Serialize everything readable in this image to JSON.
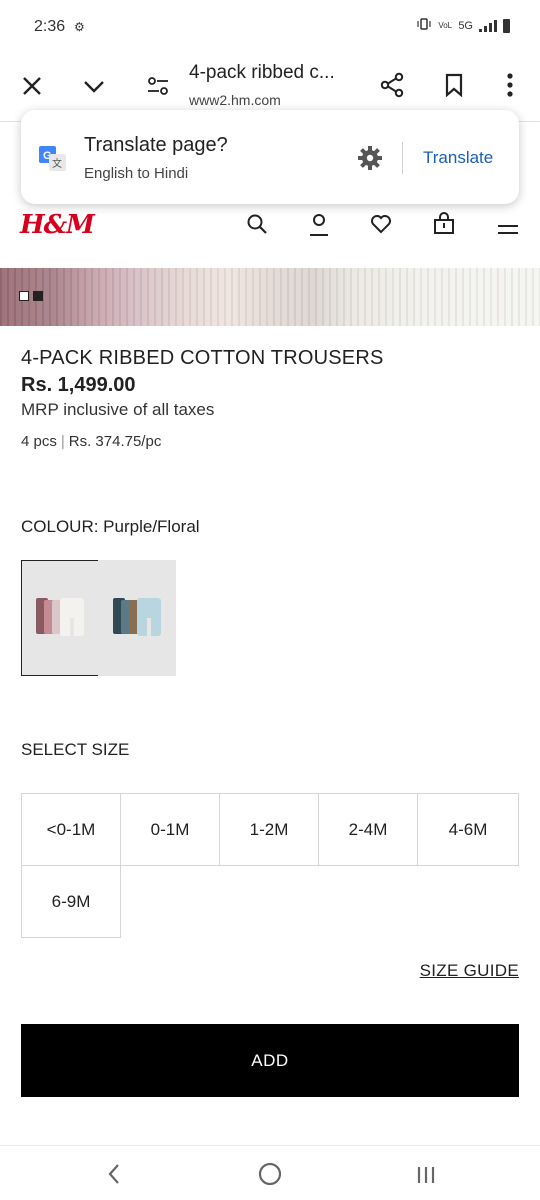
{
  "status_bar": {
    "time": "2:36",
    "network": "5G",
    "volte": "VoLTE"
  },
  "browser": {
    "page_title": "4-pack ribbed c...",
    "url": "www2.hm.com"
  },
  "translate_prompt": {
    "title": "Translate page?",
    "subtitle": "English to Hindi",
    "action": "Translate",
    "action_color": "#1a5fb4"
  },
  "site": {
    "logo": "H&M",
    "brand_color": "#d6001c"
  },
  "gallery": {
    "slides_total": 2,
    "active_slide": 2
  },
  "product": {
    "name": "4-PACK RIBBED COTTON TROUSERS",
    "price": "Rs. 1,499.00",
    "mrp_note": "MRP inclusive of all taxes",
    "pack_count": "4 pcs",
    "per_piece": "Rs. 374.75/pc"
  },
  "colour": {
    "label": "COLOUR: Purple/Floral",
    "swatches": [
      {
        "name": "Purple/Floral",
        "selected": true
      },
      {
        "name": "Blue/Grey",
        "selected": false
      }
    ]
  },
  "size": {
    "label": "SELECT SIZE",
    "options": [
      "<0-1M",
      "0-1M",
      "1-2M",
      "2-4M",
      "4-6M",
      "6-9M"
    ],
    "guide_label": "SIZE GUIDE"
  },
  "cta": {
    "add_label": "ADD"
  }
}
